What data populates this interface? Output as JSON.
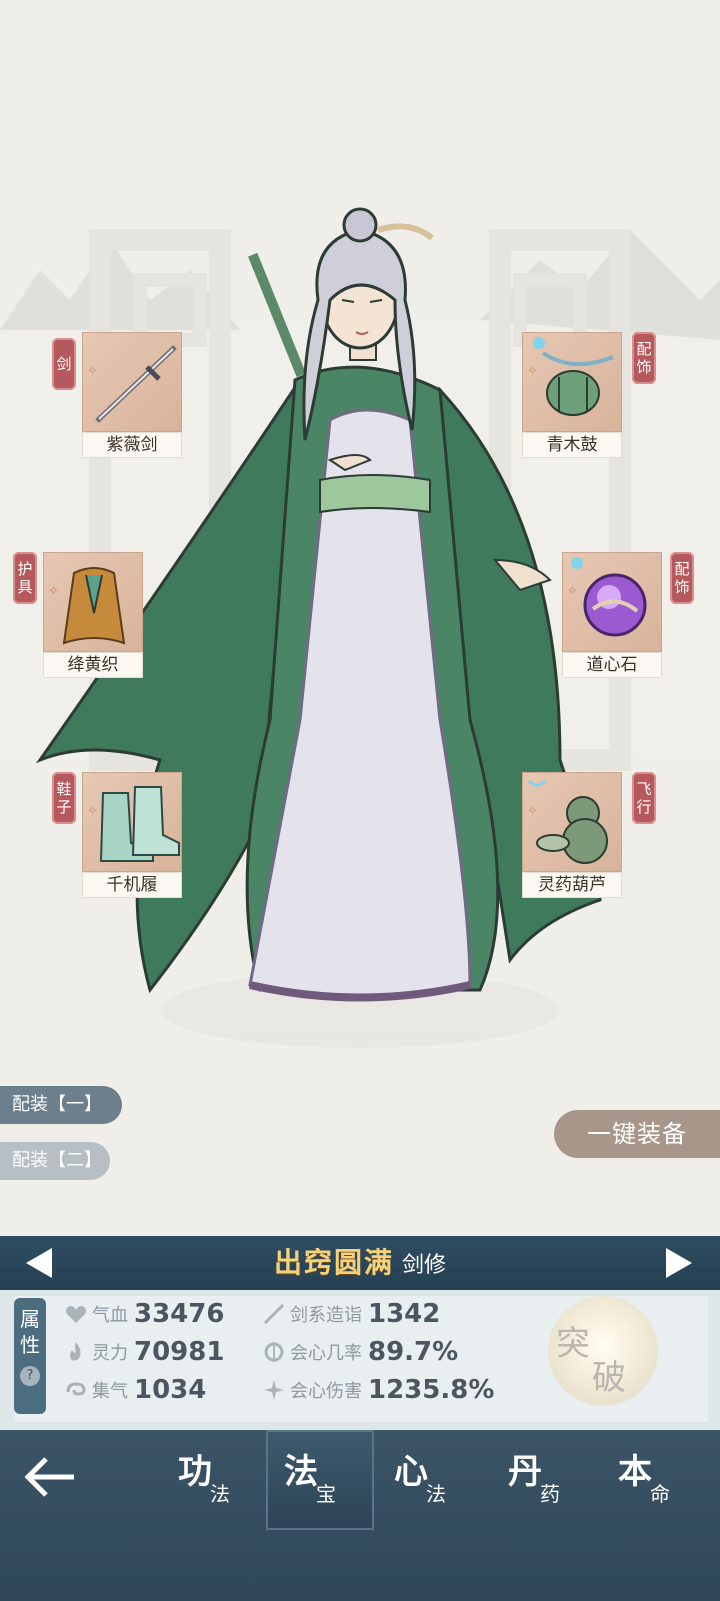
{
  "colors": {
    "accent_red": "#b6595c",
    "realm_gold": "#f6d27a",
    "panel_blue": "#2f4e63",
    "nav_blue": "#3b5466"
  },
  "equipment": {
    "weapon": {
      "category": "剑",
      "name": "紫薇剑",
      "icon": "sword-icon"
    },
    "armor": {
      "category": "护具",
      "name": "绛黄织",
      "icon": "armor-icon"
    },
    "shoes": {
      "category": "鞋子",
      "name": "千机履",
      "icon": "boots-icon"
    },
    "accessory1": {
      "category": "配饰",
      "name": "青木鼓",
      "icon": "drum-icon"
    },
    "accessory2": {
      "category": "配饰",
      "name": "道心石",
      "icon": "orb-icon"
    },
    "flying": {
      "category": "飞行",
      "name": "灵药葫芦",
      "icon": "gourd-icon"
    }
  },
  "loadouts": [
    "配装【一】",
    "配装【二】"
  ],
  "equip_all_label": "一键装备",
  "realm": {
    "name": "出窍圆满",
    "class": "剑修"
  },
  "attributes": {
    "tag": "属性",
    "tag_line1": "属",
    "tag_line2": "性",
    "help": "?",
    "stats": [
      {
        "label": "气血",
        "value": "33476",
        "icon": "heart-icon"
      },
      {
        "label": "灵力",
        "value": "70981",
        "icon": "flame-icon"
      },
      {
        "label": "集气",
        "value": "1034",
        "icon": "swirl-icon"
      },
      {
        "label": "剑系造诣",
        "value": "1342",
        "icon": "sword-skill-icon"
      },
      {
        "label": "会心几率",
        "value": "89.7%",
        "icon": "crit-rate-icon"
      },
      {
        "label": "会心伤害",
        "value": "1235.8%",
        "icon": "crit-damage-icon"
      }
    ]
  },
  "breakthrough": {
    "char1": "突",
    "char2": "破"
  },
  "nav": {
    "tabs": [
      {
        "big": "功",
        "small": "法"
      },
      {
        "big": "法",
        "small": "宝"
      },
      {
        "big": "心",
        "small": "法"
      },
      {
        "big": "丹",
        "small": "药"
      },
      {
        "big": "本",
        "small": "命"
      }
    ],
    "active_index": 1
  }
}
